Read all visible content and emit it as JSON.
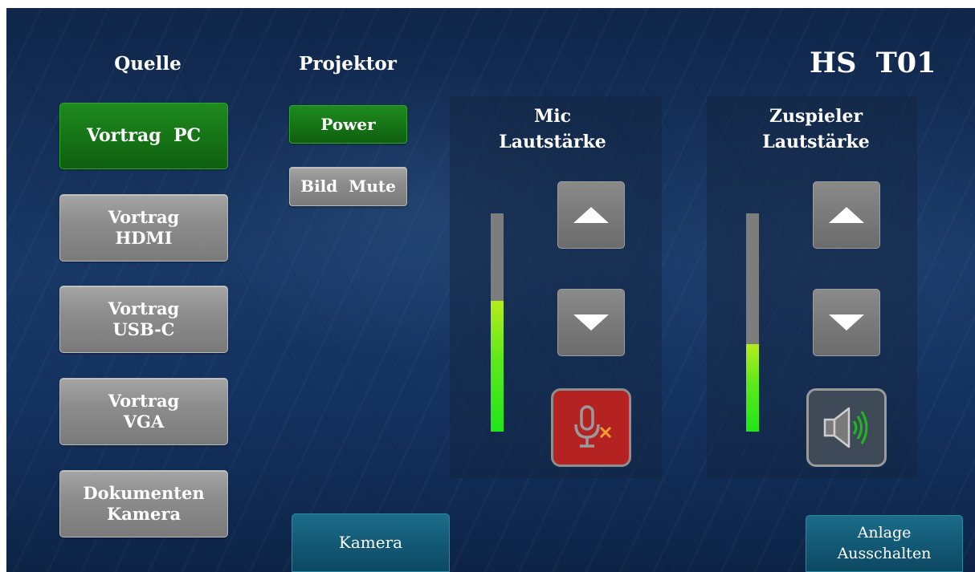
{
  "room": {
    "title": "HS  T01"
  },
  "source": {
    "heading": "Quelle",
    "buttons": [
      {
        "line1": "Vortrag  PC",
        "line2": "",
        "active": true
      },
      {
        "line1": "Vortrag",
        "line2": "HDMI",
        "active": false
      },
      {
        "line1": "Vortrag",
        "line2": "USB-C",
        "active": false
      },
      {
        "line1": "Vortrag",
        "line2": "VGA",
        "active": false
      },
      {
        "line1": "Dokumenten",
        "line2": "Kamera",
        "active": false
      }
    ]
  },
  "projector": {
    "heading": "Projektor",
    "power_label": "Power",
    "mute_label": "Bild  Mute"
  },
  "mic": {
    "heading_line1": "Mic",
    "heading_line2": "Lautstärke",
    "level": 0.6,
    "muted": true,
    "icon": "microphone-muted-icon"
  },
  "playback": {
    "heading_line1": "Zuspieler",
    "heading_line2": "Lautstärke",
    "level": 0.4,
    "icon": "speaker-icon"
  },
  "footer": {
    "camera_label": "Kamera",
    "shutdown_line1": "Anlage",
    "shutdown_line2": "Ausschalten"
  },
  "colors": {
    "active_green": "#177717",
    "meter_green": "#1fe61a",
    "mute_red": "#b52222",
    "speaker_green": "#1fb81f",
    "teal": "#135a76"
  }
}
